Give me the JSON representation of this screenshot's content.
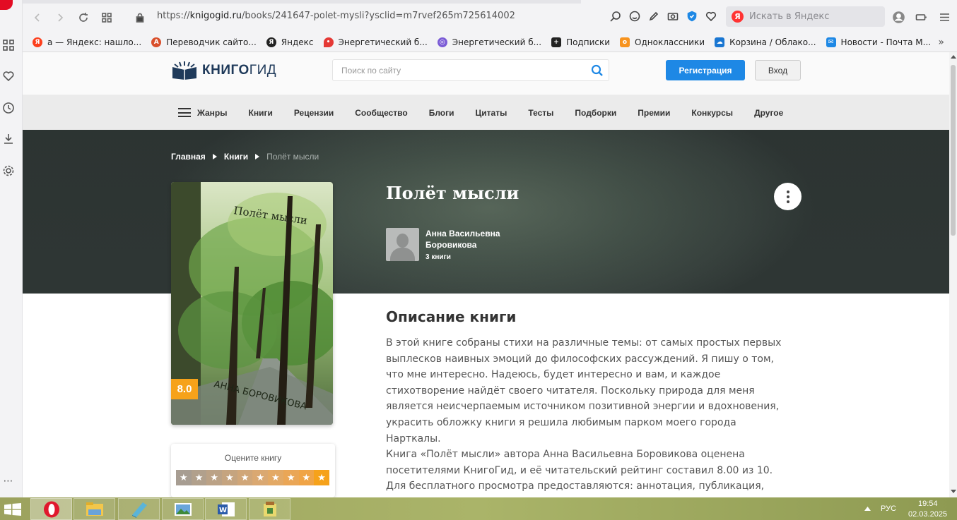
{
  "browser": {
    "url_prefix": "https://",
    "url_domain": "knigogid.ru",
    "url_path": "/books/241647-polet-mysli?ysclid=m7rvef265m725614002",
    "search_placeholder": "Искать в Яндекс",
    "search_logo": "Я",
    "bookmarks": [
      {
        "label": "а — Яндекс: нашло...",
        "icon": "Я",
        "color": "#fc3f1d"
      },
      {
        "label": "Переводчик сайто...",
        "icon": "A",
        "color": "#d94f2b"
      },
      {
        "label": "Яндекс",
        "icon": "Я",
        "color": "#222222"
      },
      {
        "label": "Энергетический б...",
        "icon": "•",
        "color": "#e53935"
      },
      {
        "label": "Энергетический б...",
        "icon": "◎",
        "color": "#7b5cd6"
      },
      {
        "label": "Подписки",
        "icon": "+",
        "color": "#222222"
      },
      {
        "label": "Одноклассники",
        "icon": "o",
        "color": "#f7931e"
      },
      {
        "label": "Корзина / Облако...",
        "icon": "☁",
        "color": "#1976d2"
      },
      {
        "label": "Новости - Почта М...",
        "icon": "✉",
        "color": "#1e88e5"
      }
    ],
    "bookmarks_more": "»"
  },
  "site": {
    "logo_word1": "КНИГО",
    "logo_word2": "ГИД",
    "search_placeholder": "Поиск по сайту",
    "register_label": "Регистрация",
    "login_label": "Вход",
    "nav": [
      "Жанры",
      "Книги",
      "Рецензии",
      "Сообщество",
      "Блоги",
      "Цитаты",
      "Тесты",
      "Подборки",
      "Премии",
      "Конкурсы",
      "Другое"
    ]
  },
  "breadcrumb": {
    "home": "Главная",
    "books": "Книги",
    "current": "Полёт мысли"
  },
  "book": {
    "title": "Полёт мысли",
    "author_name": "Анна Васильевна Боровикова",
    "author_books": "3 книги",
    "rating": "8.0",
    "cover_title": "Полёт мысли",
    "cover_author": "АННА БОРОВИКОВА"
  },
  "rate": {
    "title": "Оцените книгу",
    "stars_total": 10
  },
  "description": {
    "heading": "Описание книги",
    "p1": "В этой книге собраны стихи на различные темы: от самых простых первых выплесков наивных эмоций до философских рассуждений. Я пишу о том, что мне интересно. Надеюсь, будет интересно и вам, и каждое стихотворение найдёт своего читателя. Поскольку природа для меня является неисчерпаемым источником позитивной энергии и вдохновения, украсить обложку книги я решила любимым парком моего города Нарткалы.",
    "p2": "Книга «Полёт мысли» автора Анна Васильевна Боровикова оценена посетителями КнигоГид, и её читательский рейтинг составил 8.00 из 10.",
    "p3": "Для бесплатного просмотра предоставляются: аннотация, публикация, отзывы, а также файлы для скачивания."
  },
  "taskbar": {
    "lang": "РУС",
    "time": "19:54",
    "date": "02.03.2025"
  }
}
